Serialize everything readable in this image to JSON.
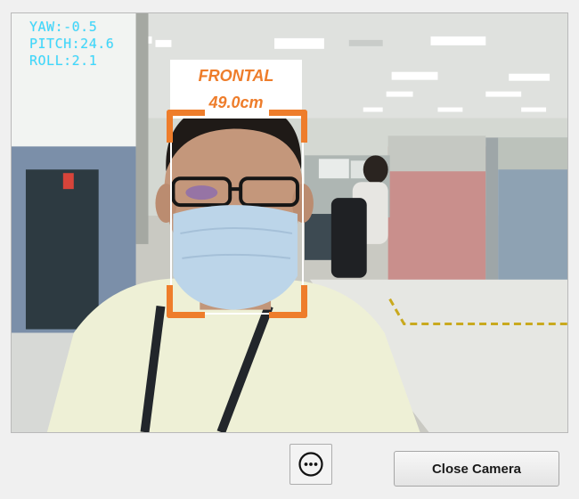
{
  "camera_view": {
    "pose": {
      "yaw": "YAW:-0.5",
      "pitch": "PITCH:24.6",
      "roll": "ROLL:2.1"
    },
    "detection": {
      "orientation": "FRONTAL",
      "distance": "49.0cm"
    }
  },
  "controls": {
    "more_icon": "more-horizontal-circle-icon",
    "close_label": "Close Camera"
  },
  "colors": {
    "accent_orange": "#ee7d2b",
    "overlay_cyan": "#3ad9ff",
    "window_bg": "#f0f0f0"
  }
}
